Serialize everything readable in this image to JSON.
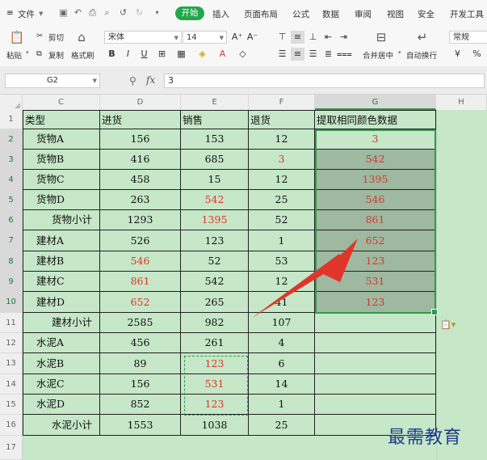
{
  "menubar": {
    "menu_icon": "≡",
    "file": "文件",
    "tabs": [
      "开始",
      "插入",
      "页面布局",
      "公式",
      "数据",
      "审阅",
      "视图",
      "安全",
      "开发工具"
    ],
    "active_tab": "开始"
  },
  "ribbon": {
    "paste": "粘贴",
    "cut": "剪切",
    "copy": "复制",
    "format_painter": "格式刷",
    "font_name": "宋体",
    "font_size": "14",
    "merge_center": "合并居中",
    "wrap_text": "自动换行",
    "number_format": "常规",
    "bold": "B",
    "italic": "I",
    "underline": "U",
    "grow_font": "A⁺",
    "shrink_font": "A⁻",
    "percent": "%"
  },
  "formula_bar": {
    "name_box": "G2",
    "fx": "fx",
    "value": "3"
  },
  "columns": [
    "C",
    "D",
    "E",
    "F",
    "G",
    "H"
  ],
  "selected_column": "G",
  "rows": [
    "1",
    "2",
    "3",
    "4",
    "5",
    "6",
    "7",
    "8",
    "9",
    "10",
    "11",
    "12",
    "13",
    "14",
    "15",
    "16",
    "17"
  ],
  "table": {
    "headers": [
      "类型",
      "进货",
      "销售",
      "退货",
      "提取相同颜色数据"
    ],
    "rows": [
      {
        "type": "货物A",
        "in": "156",
        "sale": "153",
        "ret": "12",
        "g": "3",
        "in_red": false,
        "sale_red": false,
        "ret_red": false
      },
      {
        "type": "货物B",
        "in": "416",
        "sale": "685",
        "ret": "3",
        "g": "542",
        "in_red": false,
        "sale_red": false,
        "ret_red": true
      },
      {
        "type": "货物C",
        "in": "458",
        "sale": "15",
        "ret": "12",
        "g": "1395",
        "in_red": false,
        "sale_red": false,
        "ret_red": false
      },
      {
        "type": "货物D",
        "in": "263",
        "sale": "542",
        "ret": "25",
        "g": "546",
        "in_red": false,
        "sale_red": true,
        "ret_red": false
      },
      {
        "type": "货物小计",
        "in": "1293",
        "sale": "1395",
        "ret": "52",
        "g": "861",
        "in_red": false,
        "sale_red": true,
        "ret_red": false,
        "subtotal": true
      },
      {
        "type": "建材A",
        "in": "526",
        "sale": "123",
        "ret": "1",
        "g": "652",
        "in_red": false,
        "sale_red": false,
        "ret_red": false
      },
      {
        "type": "建材B",
        "in": "546",
        "sale": "52",
        "ret": "53",
        "g": "123",
        "in_red": true,
        "sale_red": false,
        "ret_red": false
      },
      {
        "type": "建材C",
        "in": "861",
        "sale": "542",
        "ret": "12",
        "g": "531",
        "in_red": true,
        "sale_red": false,
        "ret_red": false
      },
      {
        "type": "建材D",
        "in": "652",
        "sale": "265",
        "ret": "41",
        "g": "123",
        "in_red": true,
        "sale_red": false,
        "ret_red": false
      },
      {
        "type": "建材小计",
        "in": "2585",
        "sale": "982",
        "ret": "107",
        "g": "",
        "in_red": false,
        "sale_red": false,
        "ret_red": false,
        "subtotal": true
      },
      {
        "type": "水泥A",
        "in": "456",
        "sale": "261",
        "ret": "4",
        "g": "",
        "in_red": false,
        "sale_red": false,
        "ret_red": false
      },
      {
        "type": "水泥B",
        "in": "89",
        "sale": "123",
        "ret": "6",
        "g": "",
        "in_red": false,
        "sale_red": true,
        "ret_red": false
      },
      {
        "type": "水泥C",
        "in": "156",
        "sale": "531",
        "ret": "14",
        "g": "",
        "in_red": false,
        "sale_red": true,
        "ret_red": false
      },
      {
        "type": "水泥D",
        "in": "852",
        "sale": "123",
        "ret": "1",
        "g": "",
        "in_red": false,
        "sale_red": true,
        "ret_red": false
      },
      {
        "type": "水泥小计",
        "in": "1553",
        "sale": "1038",
        "ret": "25",
        "g": "",
        "in_red": false,
        "sale_red": false,
        "ret_red": false,
        "subtotal": true
      }
    ]
  },
  "watermark": "最需教育",
  "colors": {
    "accent": "#20a84b",
    "sheet_bg": "#c6e7c8",
    "selection_fill": "#9fb8a0",
    "red_text": "#e0352b",
    "arrow": "#e0352b"
  }
}
